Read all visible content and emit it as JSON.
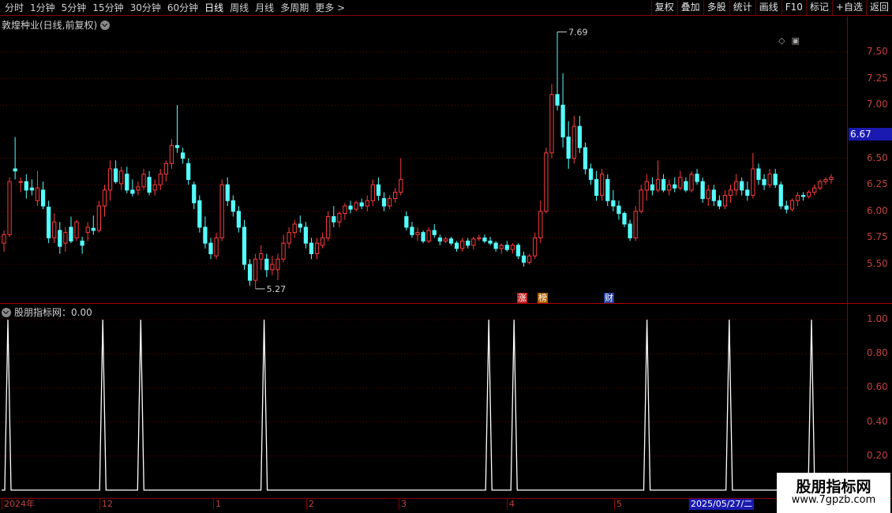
{
  "toolbar": {
    "periods": [
      "分时",
      "1分钟",
      "5分钟",
      "15分钟",
      "30分钟",
      "60分钟",
      "日线",
      "周线",
      "月线",
      "多周期",
      "更多 >"
    ],
    "active_period": "日线",
    "actions": [
      "复权",
      "叠加",
      "多股",
      "统计",
      "画线",
      "F10",
      "标记",
      "+自选",
      "返回"
    ]
  },
  "main_chart": {
    "title": "敦煌种业(日线,前复权)",
    "y_ticks": [
      "7.50",
      "7.25",
      "7.00",
      "6.50",
      "6.25",
      "6.00",
      "5.75",
      "5.50"
    ],
    "current_price_tag": "6.67",
    "high_label": "7.69",
    "low_label": "5.27",
    "event_tags": [
      "涨",
      "榜",
      "财"
    ]
  },
  "indicator": {
    "title": "股朋指标网：0.00",
    "y_ticks": [
      "1.00",
      "0.80",
      "0.60",
      "0.40",
      "0.20"
    ]
  },
  "date_axis": {
    "labels": [
      "2024年",
      "12",
      "1",
      "2",
      "3",
      "4",
      "5"
    ],
    "cursor_date": "2025/05/27/二"
  },
  "watermark": {
    "name": "股朋指标网",
    "url": "www.7gpzb.com"
  },
  "colors": {
    "up": "#ff3c3c",
    "down": "#54ffff",
    "grid": "#8b0000",
    "indicator_line": "#ffffff"
  },
  "chart_data": {
    "type": "candlestick",
    "ylim": [
      5.27,
      7.69
    ],
    "candles": [
      {
        "o": 5.7,
        "h": 5.82,
        "l": 5.62,
        "c": 5.78
      },
      {
        "o": 5.78,
        "h": 6.32,
        "l": 5.76,
        "c": 6.28
      },
      {
        "o": 6.4,
        "h": 6.7,
        "l": 6.3,
        "c": 6.38
      },
      {
        "o": 6.28,
        "h": 6.32,
        "l": 6.18,
        "c": 6.28
      },
      {
        "o": 6.28,
        "h": 6.35,
        "l": 6.12,
        "c": 6.2
      },
      {
        "o": 6.22,
        "h": 6.3,
        "l": 6.15,
        "c": 6.2
      },
      {
        "o": 6.1,
        "h": 6.38,
        "l": 6.05,
        "c": 6.22
      },
      {
        "o": 6.2,
        "h": 6.28,
        "l": 6.02,
        "c": 6.05
      },
      {
        "o": 6.04,
        "h": 6.1,
        "l": 5.7,
        "c": 5.75
      },
      {
        "o": 5.75,
        "h": 5.98,
        "l": 5.7,
        "c": 5.9
      },
      {
        "o": 5.82,
        "h": 5.9,
        "l": 5.6,
        "c": 5.67
      },
      {
        "o": 5.7,
        "h": 5.85,
        "l": 5.62,
        "c": 5.8
      },
      {
        "o": 5.85,
        "h": 5.95,
        "l": 5.7,
        "c": 5.72
      },
      {
        "o": 5.75,
        "h": 5.92,
        "l": 5.72,
        "c": 5.9
      },
      {
        "o": 5.72,
        "h": 5.76,
        "l": 5.6,
        "c": 5.68
      },
      {
        "o": 5.8,
        "h": 5.9,
        "l": 5.72,
        "c": 5.85
      },
      {
        "o": 5.84,
        "h": 5.96,
        "l": 5.78,
        "c": 5.82
      },
      {
        "o": 5.82,
        "h": 6.1,
        "l": 5.8,
        "c": 6.05
      },
      {
        "o": 6.05,
        "h": 6.25,
        "l": 5.95,
        "c": 6.2
      },
      {
        "o": 6.2,
        "h": 6.48,
        "l": 6.1,
        "c": 6.4
      },
      {
        "o": 6.4,
        "h": 6.48,
        "l": 6.26,
        "c": 6.28
      },
      {
        "o": 6.26,
        "h": 6.42,
        "l": 6.2,
        "c": 6.38
      },
      {
        "o": 6.35,
        "h": 6.42,
        "l": 6.17,
        "c": 6.2
      },
      {
        "o": 6.2,
        "h": 6.3,
        "l": 6.14,
        "c": 6.17
      },
      {
        "o": 6.2,
        "h": 6.28,
        "l": 6.15,
        "c": 6.23
      },
      {
        "o": 6.23,
        "h": 6.4,
        "l": 6.2,
        "c": 6.35
      },
      {
        "o": 6.32,
        "h": 6.38,
        "l": 6.15,
        "c": 6.18
      },
      {
        "o": 6.2,
        "h": 6.3,
        "l": 6.15,
        "c": 6.25
      },
      {
        "o": 6.25,
        "h": 6.4,
        "l": 6.2,
        "c": 6.35
      },
      {
        "o": 6.35,
        "h": 6.48,
        "l": 6.28,
        "c": 6.45
      },
      {
        "o": 6.45,
        "h": 6.68,
        "l": 6.4,
        "c": 6.62
      },
      {
        "o": 6.62,
        "h": 7.0,
        "l": 6.55,
        "c": 6.6
      },
      {
        "o": 6.55,
        "h": 6.6,
        "l": 6.45,
        "c": 6.5
      },
      {
        "o": 6.45,
        "h": 6.5,
        "l": 6.25,
        "c": 6.3
      },
      {
        "o": 6.25,
        "h": 6.28,
        "l": 6.02,
        "c": 6.08
      },
      {
        "o": 6.1,
        "h": 6.15,
        "l": 5.8,
        "c": 5.85
      },
      {
        "o": 5.85,
        "h": 5.95,
        "l": 5.65,
        "c": 5.7
      },
      {
        "o": 5.7,
        "h": 5.75,
        "l": 5.55,
        "c": 5.6
      },
      {
        "o": 5.58,
        "h": 5.8,
        "l": 5.55,
        "c": 5.75
      },
      {
        "o": 5.75,
        "h": 6.3,
        "l": 5.72,
        "c": 6.25
      },
      {
        "o": 6.25,
        "h": 6.32,
        "l": 6.05,
        "c": 6.1
      },
      {
        "o": 6.1,
        "h": 6.15,
        "l": 5.95,
        "c": 6.0
      },
      {
        "o": 6.0,
        "h": 6.05,
        "l": 5.8,
        "c": 5.85
      },
      {
        "o": 5.85,
        "h": 5.92,
        "l": 5.45,
        "c": 5.5
      },
      {
        "o": 5.5,
        "h": 5.55,
        "l": 5.3,
        "c": 5.35
      },
      {
        "o": 5.35,
        "h": 5.6,
        "l": 5.27,
        "c": 5.55
      },
      {
        "o": 5.55,
        "h": 5.68,
        "l": 5.45,
        "c": 5.6
      },
      {
        "o": 5.55,
        "h": 5.6,
        "l": 5.38,
        "c": 5.45
      },
      {
        "o": 5.45,
        "h": 5.58,
        "l": 5.4,
        "c": 5.5
      },
      {
        "o": 5.45,
        "h": 5.6,
        "l": 5.35,
        "c": 5.55
      },
      {
        "o": 5.55,
        "h": 5.78,
        "l": 5.52,
        "c": 5.7
      },
      {
        "o": 5.7,
        "h": 5.85,
        "l": 5.65,
        "c": 5.8
      },
      {
        "o": 5.8,
        "h": 5.92,
        "l": 5.75,
        "c": 5.88
      },
      {
        "o": 5.88,
        "h": 5.96,
        "l": 5.8,
        "c": 5.85
      },
      {
        "o": 5.85,
        "h": 5.9,
        "l": 5.65,
        "c": 5.7
      },
      {
        "o": 5.7,
        "h": 5.75,
        "l": 5.55,
        "c": 5.6
      },
      {
        "o": 5.6,
        "h": 5.75,
        "l": 5.55,
        "c": 5.7
      },
      {
        "o": 5.68,
        "h": 5.8,
        "l": 5.65,
        "c": 5.75
      },
      {
        "o": 5.75,
        "h": 6.0,
        "l": 5.72,
        "c": 5.95
      },
      {
        "o": 5.95,
        "h": 6.05,
        "l": 5.85,
        "c": 5.9
      },
      {
        "o": 5.9,
        "h": 6.0,
        "l": 5.85,
        "c": 5.98
      },
      {
        "o": 5.98,
        "h": 6.08,
        "l": 5.92,
        "c": 6.05
      },
      {
        "o": 6.05,
        "h": 6.1,
        "l": 5.98,
        "c": 6.02
      },
      {
        "o": 6.02,
        "h": 6.1,
        "l": 6.0,
        "c": 6.08
      },
      {
        "o": 6.08,
        "h": 6.12,
        "l": 6.02,
        "c": 6.05
      },
      {
        "o": 6.05,
        "h": 6.15,
        "l": 6.0,
        "c": 6.1
      },
      {
        "o": 6.1,
        "h": 6.3,
        "l": 6.05,
        "c": 6.25
      },
      {
        "o": 6.25,
        "h": 6.32,
        "l": 6.1,
        "c": 6.15
      },
      {
        "o": 6.12,
        "h": 6.18,
        "l": 6.0,
        "c": 6.05
      },
      {
        "o": 6.05,
        "h": 6.15,
        "l": 6.02,
        "c": 6.12
      },
      {
        "o": 6.12,
        "h": 6.22,
        "l": 6.08,
        "c": 6.18
      },
      {
        "o": 6.18,
        "h": 6.5,
        "l": 6.15,
        "c": 6.3
      },
      {
        "o": 5.95,
        "h": 6.0,
        "l": 5.82,
        "c": 5.85
      },
      {
        "o": 5.85,
        "h": 5.9,
        "l": 5.75,
        "c": 5.78
      },
      {
        "o": 5.78,
        "h": 5.85,
        "l": 5.72,
        "c": 5.8
      },
      {
        "o": 5.8,
        "h": 5.82,
        "l": 5.7,
        "c": 5.72
      },
      {
        "o": 5.72,
        "h": 5.85,
        "l": 5.7,
        "c": 5.82
      },
      {
        "o": 5.82,
        "h": 5.88,
        "l": 5.75,
        "c": 5.78
      },
      {
        "o": 5.75,
        "h": 5.78,
        "l": 5.68,
        "c": 5.72
      },
      {
        "o": 5.72,
        "h": 5.76,
        "l": 5.7,
        "c": 5.74
      },
      {
        "o": 5.74,
        "h": 5.76,
        "l": 5.68,
        "c": 5.7
      },
      {
        "o": 5.7,
        "h": 5.72,
        "l": 5.62,
        "c": 5.65
      },
      {
        "o": 5.65,
        "h": 5.75,
        "l": 5.62,
        "c": 5.72
      },
      {
        "o": 5.72,
        "h": 5.75,
        "l": 5.65,
        "c": 5.68
      },
      {
        "o": 5.68,
        "h": 5.76,
        "l": 5.64,
        "c": 5.74
      },
      {
        "o": 5.74,
        "h": 5.78,
        "l": 5.72,
        "c": 5.75
      },
      {
        "o": 5.75,
        "h": 5.78,
        "l": 5.7,
        "c": 5.72
      },
      {
        "o": 5.72,
        "h": 5.76,
        "l": 5.68,
        "c": 5.7
      },
      {
        "o": 5.7,
        "h": 5.72,
        "l": 5.62,
        "c": 5.65
      },
      {
        "o": 5.65,
        "h": 5.7,
        "l": 5.6,
        "c": 5.68
      },
      {
        "o": 5.68,
        "h": 5.72,
        "l": 5.62,
        "c": 5.64
      },
      {
        "o": 5.64,
        "h": 5.7,
        "l": 5.6,
        "c": 5.68
      },
      {
        "o": 5.68,
        "h": 5.7,
        "l": 5.55,
        "c": 5.58
      },
      {
        "o": 5.58,
        "h": 5.62,
        "l": 5.48,
        "c": 5.52
      },
      {
        "o": 5.52,
        "h": 5.6,
        "l": 5.5,
        "c": 5.58
      },
      {
        "o": 5.58,
        "h": 5.8,
        "l": 5.55,
        "c": 5.75
      },
      {
        "o": 5.75,
        "h": 6.1,
        "l": 5.7,
        "c": 6.0
      },
      {
        "o": 6.0,
        "h": 6.6,
        "l": 5.98,
        "c": 6.55
      },
      {
        "o": 6.55,
        "h": 7.2,
        "l": 6.5,
        "c": 7.1
      },
      {
        "o": 7.1,
        "h": 7.69,
        "l": 6.95,
        "c": 7.0
      },
      {
        "o": 7.0,
        "h": 7.3,
        "l": 6.6,
        "c": 6.7
      },
      {
        "o": 6.7,
        "h": 6.85,
        "l": 6.4,
        "c": 6.5
      },
      {
        "o": 6.5,
        "h": 6.9,
        "l": 6.45,
        "c": 6.8
      },
      {
        "o": 6.8,
        "h": 6.9,
        "l": 6.55,
        "c": 6.6
      },
      {
        "o": 6.6,
        "h": 6.65,
        "l": 6.35,
        "c": 6.4
      },
      {
        "o": 6.4,
        "h": 6.45,
        "l": 6.25,
        "c": 6.3
      },
      {
        "o": 6.3,
        "h": 6.38,
        "l": 6.1,
        "c": 6.15
      },
      {
        "o": 6.15,
        "h": 6.4,
        "l": 6.1,
        "c": 6.35
      },
      {
        "o": 6.3,
        "h": 6.35,
        "l": 6.05,
        "c": 6.1
      },
      {
        "o": 6.1,
        "h": 6.2,
        "l": 6.0,
        "c": 6.05
      },
      {
        "o": 6.05,
        "h": 6.1,
        "l": 5.92,
        "c": 5.98
      },
      {
        "o": 5.98,
        "h": 6.0,
        "l": 5.85,
        "c": 5.88
      },
      {
        "o": 5.88,
        "h": 5.92,
        "l": 5.72,
        "c": 5.75
      },
      {
        "o": 5.75,
        "h": 6.05,
        "l": 5.72,
        "c": 6.0
      },
      {
        "o": 6.0,
        "h": 6.25,
        "l": 5.98,
        "c": 6.2
      },
      {
        "o": 6.2,
        "h": 6.35,
        "l": 6.1,
        "c": 6.28
      },
      {
        "o": 6.25,
        "h": 6.32,
        "l": 6.15,
        "c": 6.2
      },
      {
        "o": 6.2,
        "h": 6.48,
        "l": 6.18,
        "c": 6.3
      },
      {
        "o": 6.3,
        "h": 6.35,
        "l": 6.18,
        "c": 6.2
      },
      {
        "o": 6.2,
        "h": 6.3,
        "l": 6.15,
        "c": 6.25
      },
      {
        "o": 6.25,
        "h": 6.32,
        "l": 6.18,
        "c": 6.22
      },
      {
        "o": 6.22,
        "h": 6.38,
        "l": 6.2,
        "c": 6.32
      },
      {
        "o": 6.28,
        "h": 6.32,
        "l": 6.18,
        "c": 6.2
      },
      {
        "o": 6.2,
        "h": 6.38,
        "l": 6.18,
        "c": 6.35
      },
      {
        "o": 6.35,
        "h": 6.4,
        "l": 6.25,
        "c": 6.28
      },
      {
        "o": 6.28,
        "h": 6.32,
        "l": 6.08,
        "c": 6.12
      },
      {
        "o": 6.12,
        "h": 6.25,
        "l": 6.05,
        "c": 6.2
      },
      {
        "o": 6.2,
        "h": 6.25,
        "l": 6.05,
        "c": 6.1
      },
      {
        "o": 6.1,
        "h": 6.15,
        "l": 6.02,
        "c": 6.05
      },
      {
        "o": 6.05,
        "h": 6.2,
        "l": 6.02,
        "c": 6.15
      },
      {
        "o": 6.15,
        "h": 6.25,
        "l": 6.08,
        "c": 6.2
      },
      {
        "o": 6.2,
        "h": 6.35,
        "l": 6.15,
        "c": 6.28
      },
      {
        "o": 6.28,
        "h": 6.32,
        "l": 6.15,
        "c": 6.2
      },
      {
        "o": 6.2,
        "h": 6.28,
        "l": 6.1,
        "c": 6.15
      },
      {
        "o": 6.15,
        "h": 6.55,
        "l": 6.12,
        "c": 6.4
      },
      {
        "o": 6.4,
        "h": 6.45,
        "l": 6.25,
        "c": 6.3
      },
      {
        "o": 6.3,
        "h": 6.35,
        "l": 6.2,
        "c": 6.25
      },
      {
        "o": 6.25,
        "h": 6.4,
        "l": 6.22,
        "c": 6.35
      },
      {
        "o": 6.35,
        "h": 6.4,
        "l": 6.22,
        "c": 6.25
      },
      {
        "o": 6.25,
        "h": 6.28,
        "l": 6.02,
        "c": 6.05
      },
      {
        "o": 6.05,
        "h": 6.1,
        "l": 5.98,
        "c": 6.02
      },
      {
        "o": 6.02,
        "h": 6.12,
        "l": 6.0,
        "c": 6.1
      },
      {
        "o": 6.1,
        "h": 6.18,
        "l": 6.05,
        "c": 6.15
      },
      {
        "o": 6.15,
        "h": 6.18,
        "l": 6.1,
        "c": 6.14
      },
      {
        "o": 6.14,
        "h": 6.2,
        "l": 6.12,
        "c": 6.18
      },
      {
        "o": 6.18,
        "h": 6.25,
        "l": 6.15,
        "c": 6.22
      },
      {
        "o": 6.22,
        "h": 6.3,
        "l": 6.2,
        "c": 6.28
      },
      {
        "o": 6.28,
        "h": 6.32,
        "l": 6.25,
        "c": 6.3
      },
      {
        "o": 6.3,
        "h": 6.35,
        "l": 6.26,
        "c": 6.32
      }
    ],
    "indicator_pulses": [
      2,
      32,
      44,
      83,
      154,
      162,
      204,
      230,
      256
    ],
    "indicator_bars": 262,
    "indicator_ylim": [
      0,
      1.0
    ]
  }
}
